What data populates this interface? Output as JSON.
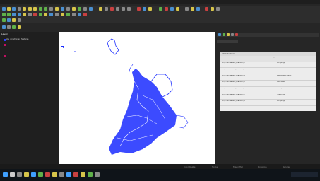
{
  "app": {
    "title": "QGIS"
  },
  "layers_panel": {
    "title": "Layers",
    "items": [
      {
        "label": "pts_constrained_features",
        "color": "#2b40ff"
      },
      {
        "label": "shoreline",
        "color": "#c01060"
      },
      {
        "label": "parcels",
        "color": "#c01060"
      }
    ]
  },
  "attribute_table": {
    "title": "Attribute table",
    "columns": [
      "id",
      "",
      "type",
      "name"
    ],
    "rows": [
      [
        "P01_CONSTRAINED_FEATURES_2",
        "1",
        "",
        "Hot springs"
      ],
      [
        "P01_CONSTRAINED_FEATURES_3",
        "2",
        "",
        "Mud Creek Shores"
      ],
      [
        "P01_CONSTRAINED_FEATURES_4",
        "2",
        "",
        "Malheur Rock Marsh"
      ],
      [
        "P01_CONSTRAINED_FEATURES_5",
        "3",
        "",
        "Fossil Beds"
      ],
      [
        "P01_CONSTRAINED_FEATURES_6",
        "4",
        "",
        "Antelope Flat"
      ],
      [
        "P01_CONSTRAINED_FEATURES_7",
        "5",
        "",
        "Quarry Lake"
      ],
      [
        "P01_CONSTRAINED_FEATURES_8",
        "6",
        "",
        "Hot springs"
      ]
    ]
  },
  "status": {
    "coordinate": "Coordinate",
    "scale": "Scale",
    "magnifier": "Magnifier",
    "rotation": "Rotation",
    "render": "Render"
  },
  "colors": {
    "map_features": "#1a2cff",
    "toolbar_icon": "#d6c44a",
    "accent": "#3fa0ff"
  }
}
